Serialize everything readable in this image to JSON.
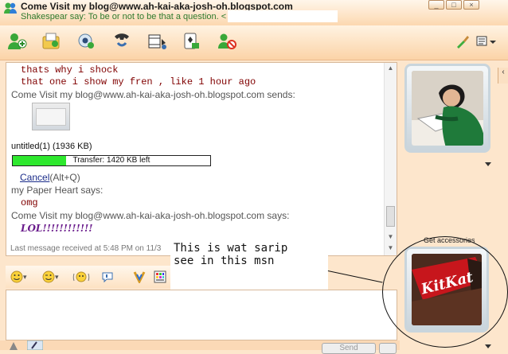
{
  "window": {
    "title": "Come Visit my blog@www.ah-kai-aka-josh-oh.blogspot.com",
    "subtitle": "Shakespear say: To be or not to be that a question. <",
    "controls": [
      "_",
      "□",
      "×"
    ]
  },
  "toolbar": {
    "items": [
      "invite-icon",
      "send-files-icon",
      "webcam-icon",
      "call-icon",
      "activities-icon",
      "games-icon",
      "block-icon",
      "paint-icon",
      "menu-icon"
    ]
  },
  "conversation": {
    "line1": "thats why i shock",
    "line2": "that one i show my fren , like 1 hour ago",
    "sends": "Come Visit my blog@www.ah-kai-aka-josh-oh.blogspot.com sends:",
    "file_name": "untitled(1) (1936 KB)",
    "transfer_text": "Transfer: 1420 KB left",
    "transfer_progress": 0.27,
    "cancel_label": "Cancel",
    "cancel_shortcut": "(Alt+Q)",
    "paper_heart_says": "my Paper Heart says:",
    "omg": "omg",
    "visit_says": "Come Visit my blog@www.ah-kai-aka-josh-oh.blogspot.com says:",
    "lol": "LOL!!!!!!!!!!!!"
  },
  "status": {
    "last_message": "Last message received at 5:48 PM on 11/3"
  },
  "annotation": {
    "text": "This is wat sarip\nsee in this msn"
  },
  "accessories": {
    "label": "Get accessories"
  },
  "bottom": {
    "send_label": "Send"
  }
}
